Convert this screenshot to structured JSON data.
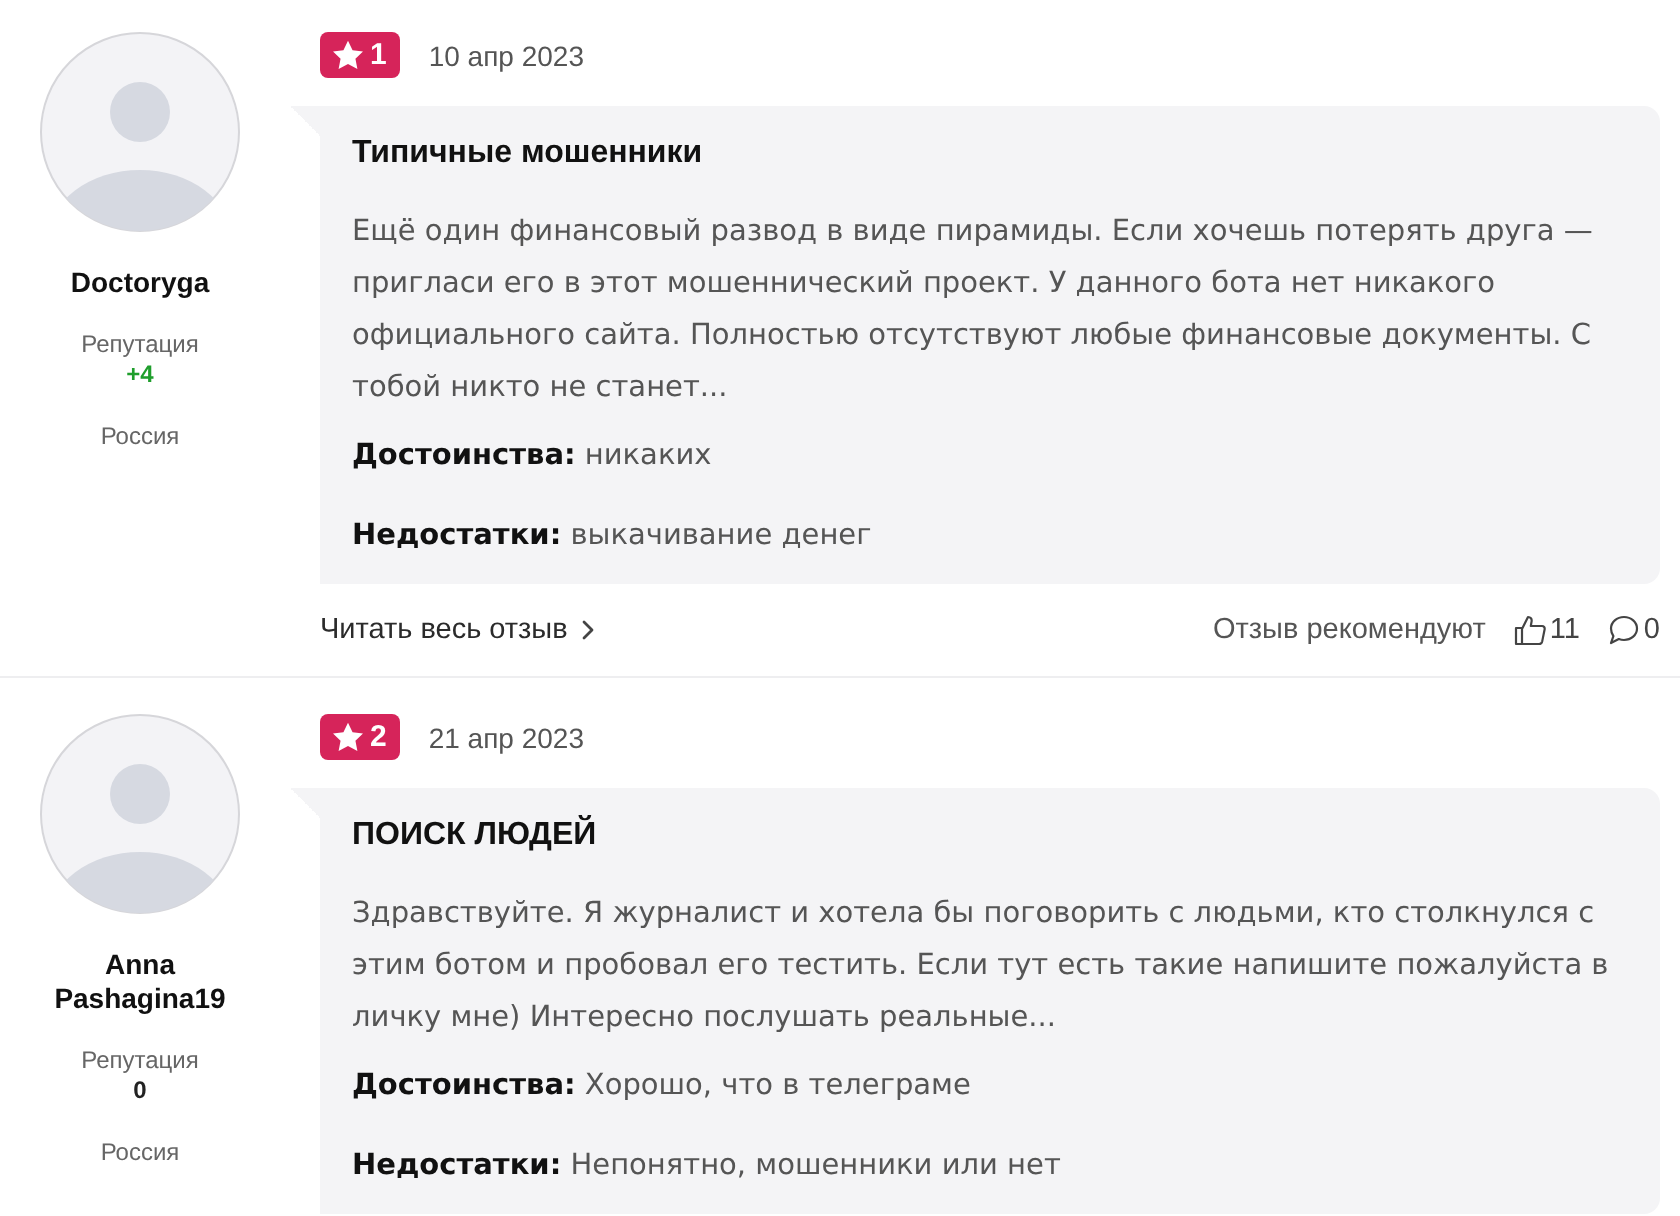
{
  "reviews": [
    {
      "author": {
        "name": "Doctoryga",
        "reputation": {
          "label": "Репутация",
          "value": "+4",
          "color": "#1f9e2c"
        },
        "country": "Россия"
      },
      "rating": "1",
      "date": "10 апр 2023",
      "title": "Типичные мошенники",
      "text": "Ещё один финансовый развод в виде пирамиды. Если хочешь потерять друга — пригласи его в этот мошеннический проект. У данного бота нет никакого официального сайта. Полностью отсутствуют любые финансовые документы. С тобой никто не станет...",
      "pros": "**Достоинства:** никаких",
      "cons": "**Недостатки:** выкачивание денег",
      "footer": {
        "read_more": "Читать весь отзыв",
        "recommend_label": "Отзыв рекомендуют",
        "likes": "11",
        "comments": "0"
      }
    },
    {
      "author": {
        "name": "Anna Pashagina19",
        "reputation": {
          "label": "Репутация",
          "value": "0",
          "color": "#222222"
        },
        "country": "Россия"
      },
      "rating": "2",
      "date": "21 апр 2023",
      "title": "ПОИСК ЛЮДЕЙ",
      "text": "Здравствуйте. Я журналист и хотела бы поговорить с людьми, кто столкнулся с этим ботом и пробовал его тестить. Если тут есть такие напишите пожалуйста в личку мне) Интересно послушать реальные...",
      "pros": "**Достоинства:** Хорошо, что в телеграме",
      "cons": "**Недостатки:** Непонятно, мошенники или нет"
    }
  ]
}
